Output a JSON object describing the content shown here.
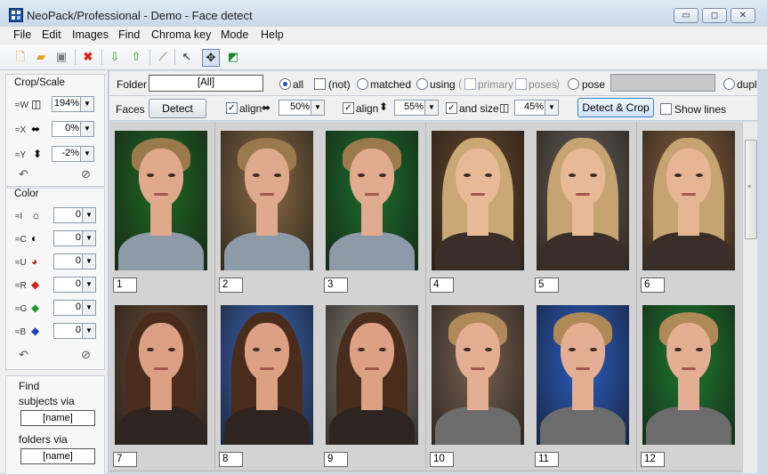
{
  "window": {
    "title": "NeoPack/Professional - Demo - Face detect",
    "min": "▭",
    "max": "◻",
    "close": "✕"
  },
  "menu": [
    "File",
    "Edit",
    "Images",
    "Find",
    "Chroma key",
    "Mode",
    "Help"
  ],
  "toolbar_icons": [
    "new-icon",
    "open-folder-icon",
    "save-icon",
    "delete-icon",
    "import-icon",
    "export-icon",
    "brush-icon",
    "pointer-icon",
    "move-icon",
    "crop-export-icon"
  ],
  "left": {
    "crop_title": "Crop/Scale",
    "crop_rows": [
      {
        "label": "≈W",
        "value": "194%"
      },
      {
        "label": "≈X",
        "value": "0%"
      },
      {
        "label": "≈Y",
        "value": "-2%"
      }
    ],
    "color_title": "Color",
    "color_rows": [
      {
        "label": "≈I",
        "value": "0"
      },
      {
        "label": "≈C",
        "value": "0"
      },
      {
        "label": "≈U",
        "value": "0"
      },
      {
        "label": "≈R",
        "value": "0"
      },
      {
        "label": "≈G",
        "value": "0"
      },
      {
        "label": "≈B",
        "value": "0"
      }
    ],
    "find_title": "Find",
    "find_subjects": "subjects via",
    "find_subjects_value": "[name]",
    "find_folders": "folders via",
    "find_folders_value": "[name]"
  },
  "filter": {
    "folder_label": "Folder",
    "folder_value": "[All]",
    "all": "all",
    "not": "(not)",
    "matched": "matched",
    "using": "using",
    "primary": "primary",
    "poses": "poses",
    "pose": "pose",
    "dupli": "dupli"
  },
  "faces": {
    "label": "Faces",
    "detect": "Detect",
    "align1": "align",
    "align1_value": "50%",
    "align2": "align",
    "align2_value": "55%",
    "and_size": "and size",
    "size_value": "45%",
    "detect_crop": "Detect & Crop",
    "show_lines": "Show lines"
  },
  "thumbnails": [
    {
      "num": "1",
      "bg": "#1f6a24",
      "skin": "#e0a98c",
      "hair": "#9a7a4c",
      "shirt": "#8d9aa8",
      "long": false
    },
    {
      "num": "2",
      "bg": "#8a6a45",
      "skin": "#dfa98d",
      "hair": "#9a7a4c",
      "shirt": "#8d9aa8",
      "long": false
    },
    {
      "num": "3",
      "bg": "#1d6f2d",
      "skin": "#e1ab8f",
      "hair": "#9a7a4c",
      "shirt": "#8d9aa8",
      "long": false
    },
    {
      "num": "4",
      "bg": "#6a4a2e",
      "skin": "#e8b997",
      "hair": "#c9a874",
      "shirt": "#3a2e28",
      "long": true
    },
    {
      "num": "5",
      "bg": "#6d6158",
      "skin": "#e8b997",
      "hair": "#c5a472",
      "shirt": "#3a2e28",
      "long": true
    },
    {
      "num": "6",
      "bg": "#8b6340",
      "skin": "#e6b694",
      "hair": "#c5a472",
      "shirt": "#3a2e28",
      "long": true
    },
    {
      "num": "7",
      "bg": "#6b4d35",
      "skin": "#dca184",
      "hair": "#4a2c1c",
      "shirt": "#2e2521",
      "long": true
    },
    {
      "num": "8",
      "bg": "#3d68b8",
      "skin": "#dca184",
      "hair": "#4a2c1c",
      "shirt": "#2e2521",
      "long": true
    },
    {
      "num": "9",
      "bg": "#8d8378",
      "skin": "#dca184",
      "hair": "#4a2c1c",
      "shirt": "#2e2521",
      "long": true
    },
    {
      "num": "10",
      "bg": "#7a6150",
      "skin": "#e3ae92",
      "hair": "#b08958",
      "shirt": "#6c6c6c",
      "long": false
    },
    {
      "num": "11",
      "bg": "#2c5ec2",
      "skin": "#e3ae92",
      "hair": "#b08958",
      "shirt": "#6c6c6c",
      "long": false
    },
    {
      "num": "12",
      "bg": "#1f7a30",
      "skin": "#e3ae92",
      "hair": "#b08958",
      "shirt": "#6c6c6c",
      "long": false
    }
  ]
}
